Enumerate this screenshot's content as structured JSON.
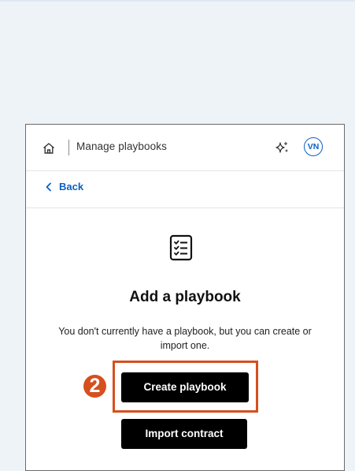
{
  "header": {
    "title": "Manage playbooks",
    "avatar_initials": "VN",
    "home_icon": "home-icon",
    "sparkle_icon": "sparkle-icon"
  },
  "nav": {
    "back_label": "Back",
    "back_icon": "chevron-left-icon"
  },
  "empty_state": {
    "icon": "checklist-icon",
    "title": "Add a playbook",
    "description": "You don't currently have a playbook, but you can create or import one.",
    "create_label": "Create playbook",
    "import_label": "Import contract"
  },
  "annotation": {
    "step_number": "2",
    "color": "#d64f1e"
  },
  "colors": {
    "accent": "#0b60c5",
    "button_bg": "#000000",
    "page_bg": "#eef3f8"
  }
}
